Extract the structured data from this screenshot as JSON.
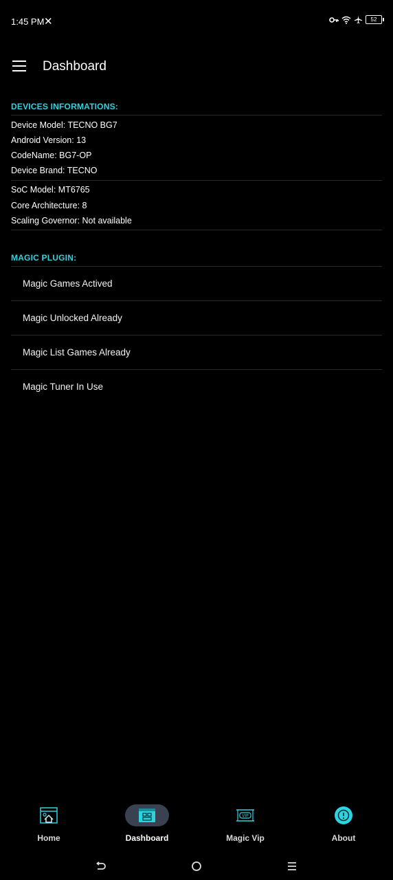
{
  "status_bar": {
    "time": "1:45 PM",
    "notification_glyph": "✕",
    "battery_level": "52",
    "icons": [
      "key-icon",
      "wifi-icon",
      "airplane-icon",
      "battery-icon"
    ]
  },
  "app_bar": {
    "title": "Dashboard",
    "menu_icon": "hamburger-menu-icon"
  },
  "devices": {
    "header": "DEVICES INFORMATIONS:",
    "model": "Device Model: TECNO BG7",
    "android": "Android Version: 13",
    "codename": "CodeName: BG7-OP",
    "brand": "Device Brand: TECNO",
    "soc": "SoC Model: MT6765",
    "core": "Core Architecture: 8",
    "governor": "Scaling Governor: Not available"
  },
  "plugin": {
    "header": "MAGIC PLUGIN:",
    "items": [
      "Magic Games Actived",
      "Magic Unlocked Already",
      "Magic List Games Already",
      "Magic Tuner In Use"
    ]
  },
  "bottom_nav": {
    "items": [
      {
        "label": "Home",
        "icon": "home-icon",
        "active": false
      },
      {
        "label": "Dashboard",
        "icon": "dashboard-icon",
        "active": true
      },
      {
        "label": "Magic Vip",
        "icon": "vip-icon",
        "active": false
      },
      {
        "label": "About",
        "icon": "info-icon",
        "active": false
      }
    ]
  },
  "colors": {
    "accent": "#2ed3e0",
    "background": "#000000",
    "active_pill": "#3a4150"
  }
}
